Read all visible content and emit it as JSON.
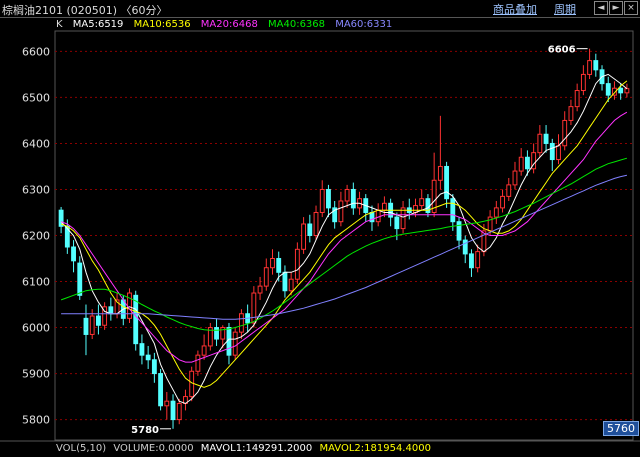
{
  "window": {
    "title": "棕榈油2101 (020501) 〈60分〉",
    "btn_products": "商品叠加",
    "btn_cycle": "周期",
    "win_controls": [
      "◄",
      "►",
      "×"
    ]
  },
  "legend": {
    "k_label": "K",
    "ma5": "MA5:6519",
    "ma10": "MA10:6536",
    "ma20": "MA20:6468",
    "ma40": "MA40:6368",
    "ma60": "MA60:6331"
  },
  "volume": {
    "label": "VOL(5,10)",
    "volume": "VOLUME:0.0000",
    "mavol1": "MAVOL1:149291.2000",
    "mavol2": "MAVOL2:181954.4000"
  },
  "price_box": "5760",
  "annotations": {
    "high": "6606",
    "low": "5780"
  },
  "colors": {
    "up": "#ff3232",
    "down": "#54ffff",
    "ma5": "#ffffff",
    "ma10": "#ffff00",
    "ma20": "#ff33ff",
    "ma40": "#00e600",
    "ma60": "#8080ff",
    "grid": "#8b0000"
  },
  "chart_data": {
    "type": "candlestick",
    "ylim": [
      5760,
      6640
    ],
    "yticks": [
      6600,
      6500,
      6400,
      6300,
      6200,
      6100,
      6000,
      5900,
      5800
    ],
    "candles": [
      [
        6255,
        6220,
        6262,
        6205
      ],
      [
        6220,
        6175,
        6235,
        6160
      ],
      [
        6175,
        6145,
        6190,
        6120
      ],
      [
        6140,
        6070,
        6155,
        6060
      ],
      [
        6020,
        5985,
        6050,
        5940
      ],
      [
        5985,
        6025,
        6040,
        5975
      ],
      [
        6025,
        6005,
        6050,
        5985
      ],
      [
        6005,
        6045,
        6055,
        5995
      ],
      [
        6045,
        6030,
        6065,
        6015
      ],
      [
        6030,
        6060,
        6075,
        6020
      ],
      [
        6060,
        6020,
        6070,
        6005
      ],
      [
        6020,
        6075,
        6085,
        6010
      ],
      [
        6070,
        5965,
        6080,
        5950
      ],
      [
        5965,
        5940,
        5985,
        5920
      ],
      [
        5940,
        5930,
        5960,
        5910
      ],
      [
        5930,
        5900,
        5945,
        5880
      ],
      [
        5900,
        5830,
        5910,
        5820
      ],
      [
        5830,
        5840,
        5860,
        5800
      ],
      [
        5840,
        5800,
        5855,
        5780
      ],
      [
        5800,
        5835,
        5845,
        5790
      ],
      [
        5835,
        5850,
        5865,
        5820
      ],
      [
        5850,
        5905,
        5915,
        5840
      ],
      [
        5905,
        5940,
        5950,
        5895
      ],
      [
        5940,
        5960,
        5985,
        5930
      ],
      [
        5960,
        6000,
        6010,
        5950
      ],
      [
        6000,
        5975,
        6020,
        5960
      ],
      [
        5975,
        6000,
        6005,
        5955
      ],
      [
        6000,
        5940,
        6010,
        5920
      ],
      [
        5940,
        5990,
        6000,
        5930
      ],
      [
        5990,
        6030,
        6040,
        5975
      ],
      [
        6030,
        6010,
        6050,
        5990
      ],
      [
        6010,
        6075,
        6090,
        6000
      ],
      [
        6075,
        6090,
        6110,
        6060
      ],
      [
        6090,
        6130,
        6150,
        6080
      ],
      [
        6130,
        6150,
        6170,
        6115
      ],
      [
        6150,
        6120,
        6165,
        6100
      ],
      [
        6120,
        6080,
        6135,
        6065
      ],
      [
        6080,
        6105,
        6120,
        6070
      ],
      [
        6105,
        6170,
        6185,
        6095
      ],
      [
        6170,
        6225,
        6240,
        6160
      ],
      [
        6225,
        6200,
        6245,
        6185
      ],
      [
        6200,
        6250,
        6265,
        6190
      ],
      [
        6250,
        6300,
        6320,
        6240
      ],
      [
        6300,
        6260,
        6310,
        6240
      ],
      [
        6260,
        6230,
        6275,
        6215
      ],
      [
        6230,
        6275,
        6295,
        6220
      ],
      [
        6275,
        6300,
        6310,
        6260
      ],
      [
        6300,
        6260,
        6315,
        6245
      ],
      [
        6260,
        6280,
        6295,
        6245
      ],
      [
        6280,
        6250,
        6290,
        6230
      ],
      [
        6250,
        6230,
        6265,
        6210
      ],
      [
        6230,
        6255,
        6270,
        6220
      ],
      [
        6255,
        6270,
        6285,
        6240
      ],
      [
        6270,
        6240,
        6280,
        6220
      ],
      [
        6240,
        6215,
        6250,
        6190
      ],
      [
        6215,
        6260,
        6275,
        6205
      ],
      [
        6260,
        6250,
        6280,
        6235
      ],
      [
        6250,
        6265,
        6280,
        6240
      ],
      [
        6265,
        6280,
        6300,
        6255
      ],
      [
        6280,
        6250,
        6290,
        6240
      ],
      [
        6250,
        6320,
        6380,
        6240
      ],
      [
        6320,
        6350,
        6460,
        6300
      ],
      [
        6350,
        6280,
        6360,
        6260
      ],
      [
        6280,
        6230,
        6290,
        6210
      ],
      [
        6230,
        6190,
        6240,
        6170
      ],
      [
        6190,
        6160,
        6200,
        6140
      ],
      [
        6160,
        6130,
        6170,
        6110
      ],
      [
        6130,
        6165,
        6180,
        6120
      ],
      [
        6165,
        6210,
        6225,
        6155
      ],
      [
        6210,
        6240,
        6255,
        6200
      ],
      [
        6240,
        6260,
        6275,
        6225
      ],
      [
        6260,
        6285,
        6300,
        6250
      ],
      [
        6285,
        6310,
        6325,
        6275
      ],
      [
        6310,
        6340,
        6360,
        6300
      ],
      [
        6340,
        6370,
        6390,
        6330
      ],
      [
        6370,
        6345,
        6385,
        6330
      ],
      [
        6345,
        6380,
        6400,
        6335
      ],
      [
        6380,
        6420,
        6440,
        6370
      ],
      [
        6420,
        6400,
        6440,
        6380
      ],
      [
        6400,
        6365,
        6410,
        6340
      ],
      [
        6365,
        6395,
        6420,
        6355
      ],
      [
        6395,
        6450,
        6470,
        6385
      ],
      [
        6450,
        6480,
        6495,
        6440
      ],
      [
        6480,
        6515,
        6530,
        6470
      ],
      [
        6515,
        6550,
        6570,
        6505
      ],
      [
        6550,
        6580,
        6606,
        6540
      ],
      [
        6580,
        6560,
        6595,
        6545
      ],
      [
        6560,
        6530,
        6570,
        6515
      ],
      [
        6530,
        6505,
        6545,
        6490
      ],
      [
        6505,
        6520,
        6535,
        6495
      ],
      [
        6520,
        6510,
        6530,
        6495
      ],
      [
        6510,
        6519,
        6530,
        6500
      ]
    ],
    "series": [
      {
        "name": "MA5",
        "values": [
          6230,
          6215,
          6200,
          6170,
          6120,
          6080,
          6055,
          6035,
          6030,
          6030,
          6040,
          6045,
          6040,
          6015,
          5990,
          5965,
          5920,
          5890,
          5865,
          5840,
          5835,
          5845,
          5860,
          5885,
          5915,
          5940,
          5960,
          5975,
          5975,
          5980,
          5990,
          6005,
          6030,
          6055,
          6085,
          6110,
          6120,
          6120,
          6125,
          6140,
          6160,
          6190,
          6220,
          6245,
          6255,
          6260,
          6265,
          6270,
          6270,
          6265,
          6260,
          6255,
          6250,
          6250,
          6245,
          6240,
          6245,
          6250,
          6255,
          6260,
          6275,
          6290,
          6295,
          6285,
          6265,
          6230,
          6195,
          6175,
          6165,
          6175,
          6195,
          6225,
          6250,
          6280,
          6310,
          6335,
          6355,
          6370,
          6385,
          6390,
          6395,
          6410,
          6425,
          6445,
          6470,
          6500,
          6530,
          6545,
          6550,
          6540,
          6530,
          6519
        ]
      },
      {
        "name": "MA10",
        "values": [
          6225,
          6220,
          6210,
          6195,
          6170,
          6145,
          6125,
          6100,
          6075,
          6055,
          6045,
          6040,
          6035,
          6030,
          6020,
          6005,
          5985,
          5960,
          5935,
          5910,
          5890,
          5880,
          5875,
          5870,
          5875,
          5885,
          5900,
          5915,
          5930,
          5945,
          5960,
          5975,
          5990,
          6005,
          6020,
          6040,
          6060,
          6075,
          6090,
          6105,
          6120,
          6140,
          6160,
          6180,
          6195,
          6205,
          6215,
          6225,
          6235,
          6245,
          6250,
          6255,
          6255,
          6255,
          6255,
          6255,
          6255,
          6255,
          6255,
          6255,
          6260,
          6265,
          6270,
          6270,
          6265,
          6255,
          6240,
          6225,
          6215,
          6210,
          6205,
          6205,
          6210,
          6220,
          6235,
          6255,
          6275,
          6295,
          6315,
          6335,
          6350,
          6365,
          6380,
          6395,
          6415,
          6435,
          6455,
          6475,
          6495,
          6510,
          6525,
          6536
        ]
      },
      {
        "name": "MA20",
        "values": [
          6230,
          6225,
          6215,
          6200,
          6180,
          6160,
          6140,
          6120,
          6100,
          6080,
          6060,
          6040,
          6025,
          6010,
          5995,
          5980,
          5965,
          5950,
          5940,
          5930,
          5925,
          5925,
          5930,
          5935,
          5940,
          5945,
          5950,
          5955,
          5960,
          5970,
          5980,
          5990,
          6000,
          6010,
          6020,
          6030,
          6040,
          6055,
          6070,
          6085,
          6100,
          6120,
          6140,
          6160,
          6175,
          6190,
          6200,
          6210,
          6220,
          6230,
          6235,
          6240,
          6245,
          6245,
          6245,
          6245,
          6245,
          6245,
          6245,
          6245,
          6245,
          6245,
          6245,
          6245,
          6240,
          6235,
          6225,
          6215,
          6205,
          6200,
          6200,
          6200,
          6205,
          6210,
          6220,
          6230,
          6245,
          6260,
          6275,
          6290,
          6305,
          6320,
          6335,
          6350,
          6365,
          6385,
          6405,
          6420,
          6435,
          6450,
          6460,
          6468
        ]
      },
      {
        "name": "MA40",
        "values": [
          6060,
          6065,
          6070,
          6075,
          6080,
          6082,
          6083,
          6083,
          6080,
          6075,
          6070,
          6064,
          6058,
          6050,
          6043,
          6036,
          6030,
          6023,
          6017,
          6011,
          6006,
          6002,
          5998,
          5995,
          5994,
          5994,
          5995,
          5997,
          6000,
          6004,
          6008,
          6013,
          6020,
          6028,
          6036,
          6045,
          6055,
          6065,
          6075,
          6085,
          6095,
          6105,
          6115,
          6125,
          6135,
          6145,
          6155,
          6163,
          6170,
          6177,
          6183,
          6188,
          6193,
          6197,
          6200,
          6203,
          6205,
          6207,
          6209,
          6211,
          6213,
          6215,
          6218,
          6220,
          6222,
          6224,
          6226,
          6228,
          6231,
          6234,
          6238,
          6242,
          6247,
          6252,
          6258,
          6264,
          6270,
          6277,
          6284,
          6291,
          6298,
          6305,
          6312,
          6320,
          6328,
          6336,
          6344,
          6350,
          6356,
          6360,
          6364,
          6368
        ]
      },
      {
        "name": "MA60",
        "values": [
          6030,
          6030,
          6030,
          6030,
          6030,
          6030,
          6030,
          6030,
          6030,
          6030,
          6030,
          6030,
          6030,
          6030,
          6030,
          6029,
          6028,
          6027,
          6026,
          6025,
          6024,
          6023,
          6022,
          6021,
          6020,
          6019,
          6018,
          6018,
          6018,
          6019,
          6020,
          6022,
          6024,
          6026,
          6028,
          6030,
          6033,
          6036,
          6039,
          6042,
          6046,
          6050,
          6054,
          6058,
          6062,
          6067,
          6072,
          6077,
          6082,
          6087,
          6093,
          6099,
          6105,
          6111,
          6117,
          6123,
          6129,
          6135,
          6141,
          6147,
          6153,
          6159,
          6165,
          6171,
          6177,
          6183,
          6189,
          6195,
          6201,
          6207,
          6213,
          6219,
          6225,
          6231,
          6237,
          6243,
          6249,
          6255,
          6261,
          6267,
          6273,
          6279,
          6285,
          6291,
          6297,
          6303,
          6309,
          6314,
          6319,
          6324,
          6328,
          6331
        ]
      }
    ]
  }
}
